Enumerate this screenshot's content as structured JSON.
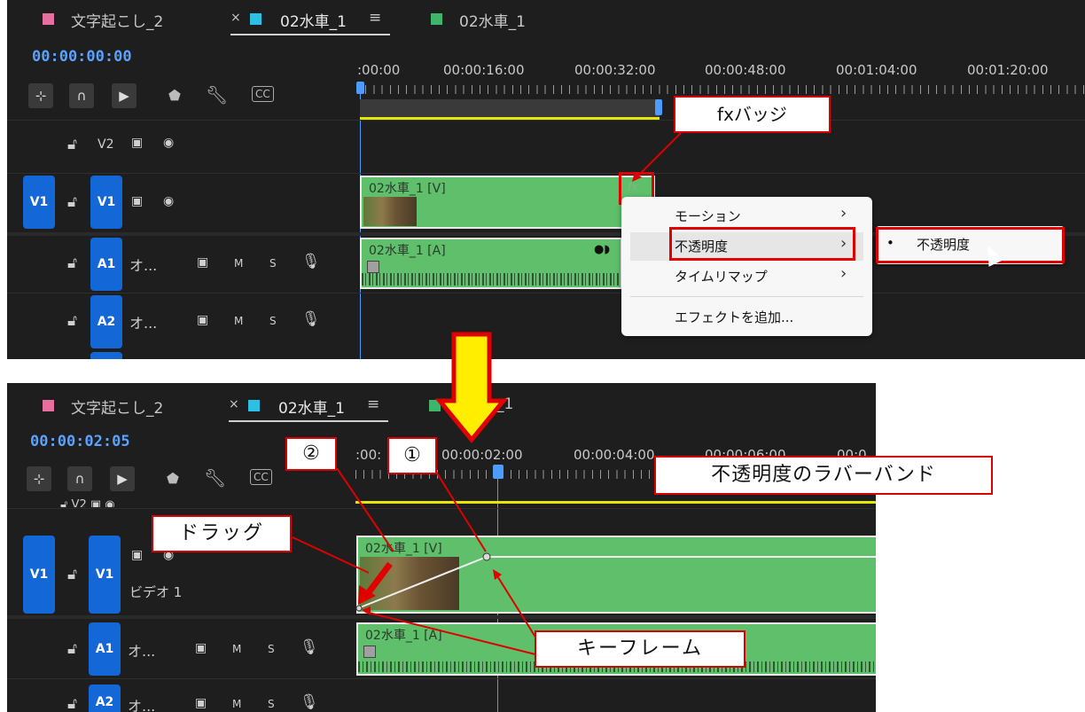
{
  "top": {
    "tabs": [
      {
        "label": "文字起こし_2",
        "color": "#e76fa0"
      },
      {
        "label": "02水車_1",
        "color": "#2bc0e4",
        "close": "×",
        "menu": "≡"
      },
      {
        "label": "02水車_1",
        "color": "#3fb56b"
      }
    ],
    "timecode": "00:00:00:00",
    "ruler": [
      ":00:00",
      "00:00:16:00",
      "00:00:32:00",
      "00:00:48:00",
      "00:01:04:00",
      "00:01:20:00"
    ],
    "tracks": {
      "v2": {
        "label": "V2"
      },
      "v1": {
        "source": "V1",
        "label": "V1"
      },
      "a1": {
        "label": "A1",
        "name": "オ...",
        "m": "M",
        "s": "S"
      },
      "a2": {
        "label": "A2",
        "name": "オ...",
        "m": "M",
        "s": "S"
      }
    },
    "clips": {
      "video": "02水車_1 [V]",
      "audio": "02水車_1 [A]",
      "fx": "fx"
    },
    "menu": {
      "items": [
        "モーション",
        "不透明度",
        "タイムリマップ",
        "エフェクトを追加..."
      ],
      "submenu": "不透明度",
      "bullet": "•"
    },
    "callout": "fxバッジ"
  },
  "bottom": {
    "tabs": [
      {
        "label": "文字起こし_2",
        "color": "#e76fa0"
      },
      {
        "label": "02水車_1",
        "color": "#2bc0e4",
        "close": "×",
        "menu": "≡"
      },
      {
        "label": "_1",
        "color": "#3fb56b"
      }
    ],
    "timecode": "00:00:02:05",
    "ruler": [
      ":00:",
      "00:00:02:00",
      "00:00:04:00",
      "00:00:06:00",
      "00:0"
    ],
    "tracks": {
      "v1": {
        "source": "V1",
        "label": "V1",
        "name": "ビデオ 1"
      },
      "a1": {
        "label": "A1",
        "name": "オ...",
        "m": "M",
        "s": "S"
      },
      "a2": {
        "label": "A2",
        "name": "オ...",
        "m": "M",
        "s": "S"
      }
    },
    "clips": {
      "video": "02水車_1 [V]",
      "audio": "02水車_1 [A]"
    },
    "callouts": {
      "num2": "②",
      "num1": "①",
      "band": "不透明度のラバーバンド",
      "drag": "ドラッグ",
      "keyframe": "キーフレーム"
    }
  },
  "colors": {
    "panel_bg": "#1e1e1e",
    "clip_green": "#5fbf6a",
    "track_target": "#1367d6",
    "playhead": "#4d9bff",
    "annotation_red": "#e00000",
    "arrow_yellow": "#ffee00"
  },
  "icons": [
    "ripple-icon",
    "snap-icon",
    "linked-select-icon",
    "marker-icon",
    "wrench-icon",
    "caption-icon",
    "lock-icon",
    "film-icon",
    "eye-icon",
    "mic-icon",
    "speaker-icon",
    "cursor-icon",
    "down-arrow-icon"
  ]
}
